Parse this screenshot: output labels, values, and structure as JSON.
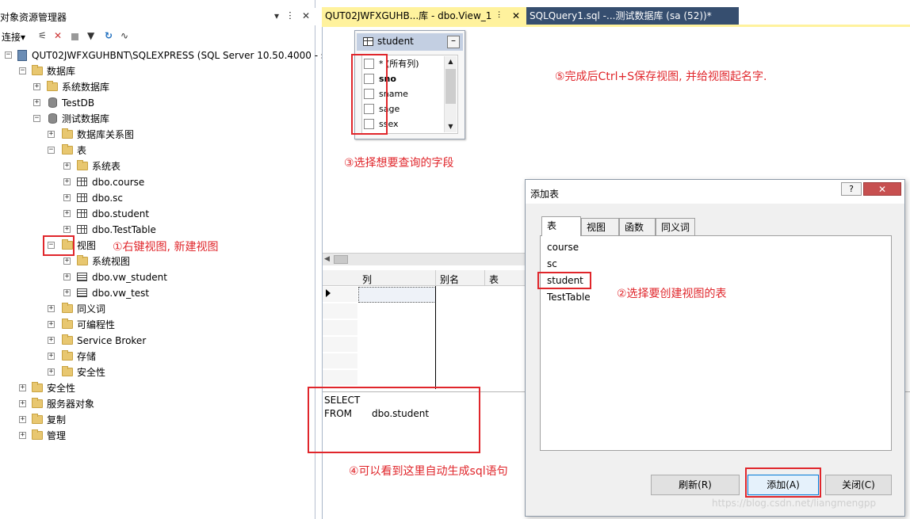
{
  "object_explorer": {
    "title": "对象资源管理器",
    "title_controls": {
      "pin_down": "▾",
      "pin": "ⵗ",
      "close": "✕"
    },
    "toolbar": {
      "connect": "连接▾"
    },
    "tree": {
      "server": "QUT02JWFXGUHBNT\\SQLEXPRESS (SQL Server 10.50.4000 - s",
      "databases": "数据库",
      "system_databases": "系统数据库",
      "testdb": "TestDB",
      "test_database": "测试数据库",
      "db_diagrams": "数据库关系图",
      "tables": "表",
      "system_tables": "系统表",
      "table_course": "dbo.course",
      "table_sc": "dbo.sc",
      "table_student": "dbo.student",
      "table_testtable": "dbo.TestTable",
      "views": "视图",
      "system_views": "系统视图",
      "view_vw_student": "dbo.vw_student",
      "view_vw_test": "dbo.vw_test",
      "synonyms": "同义词",
      "programmability": "可编程性",
      "service_broker": "Service Broker",
      "storage": "存储",
      "db_security": "安全性",
      "security": "安全性",
      "server_objects": "服务器对象",
      "replication": "复制",
      "management": "管理"
    }
  },
  "tabs": [
    {
      "label": "QUT02JWFXGUHB...库 - dbo.View_1",
      "pin": "ⵗ",
      "close": "✕"
    },
    {
      "label": "SQLQuery1.sql -...测试数据库 (sa (52))*"
    }
  ],
  "designer": {
    "table_box": {
      "name": "student",
      "minimize": "–",
      "columns": [
        "* (所有列)",
        "sno",
        "sname",
        "sage",
        "ssex"
      ]
    },
    "grid": {
      "headers": [
        "列",
        "别名",
        "表"
      ]
    },
    "sql": {
      "select_kw": "SELECT",
      "from_kw": "FROM",
      "from_obj": "dbo.student"
    }
  },
  "dialog": {
    "title": "添加表",
    "help": "?",
    "close": "✕",
    "tabs": [
      "表",
      "视图",
      "函数",
      "同义词"
    ],
    "items": [
      "course",
      "sc",
      "student",
      "TestTable"
    ],
    "buttons": {
      "refresh": "刷新(R)",
      "add": "添加(A)",
      "close": "关闭(C)"
    }
  },
  "annotations": {
    "step1": "①右键视图, 新建视图",
    "step2": "②选择要创建视图的表",
    "step3": "③选择想要查询的字段",
    "step4": "④可以看到这里自动生成sql语句",
    "step5": "⑤完成后Ctrl+S保存视图, 并给视图起名字."
  },
  "watermark": "https://blog.csdn.net/liangmengpp",
  "colors": {
    "annotation": "#e0262b",
    "active_tab": "#fff29d",
    "inactive_tab": "#364e6f"
  }
}
